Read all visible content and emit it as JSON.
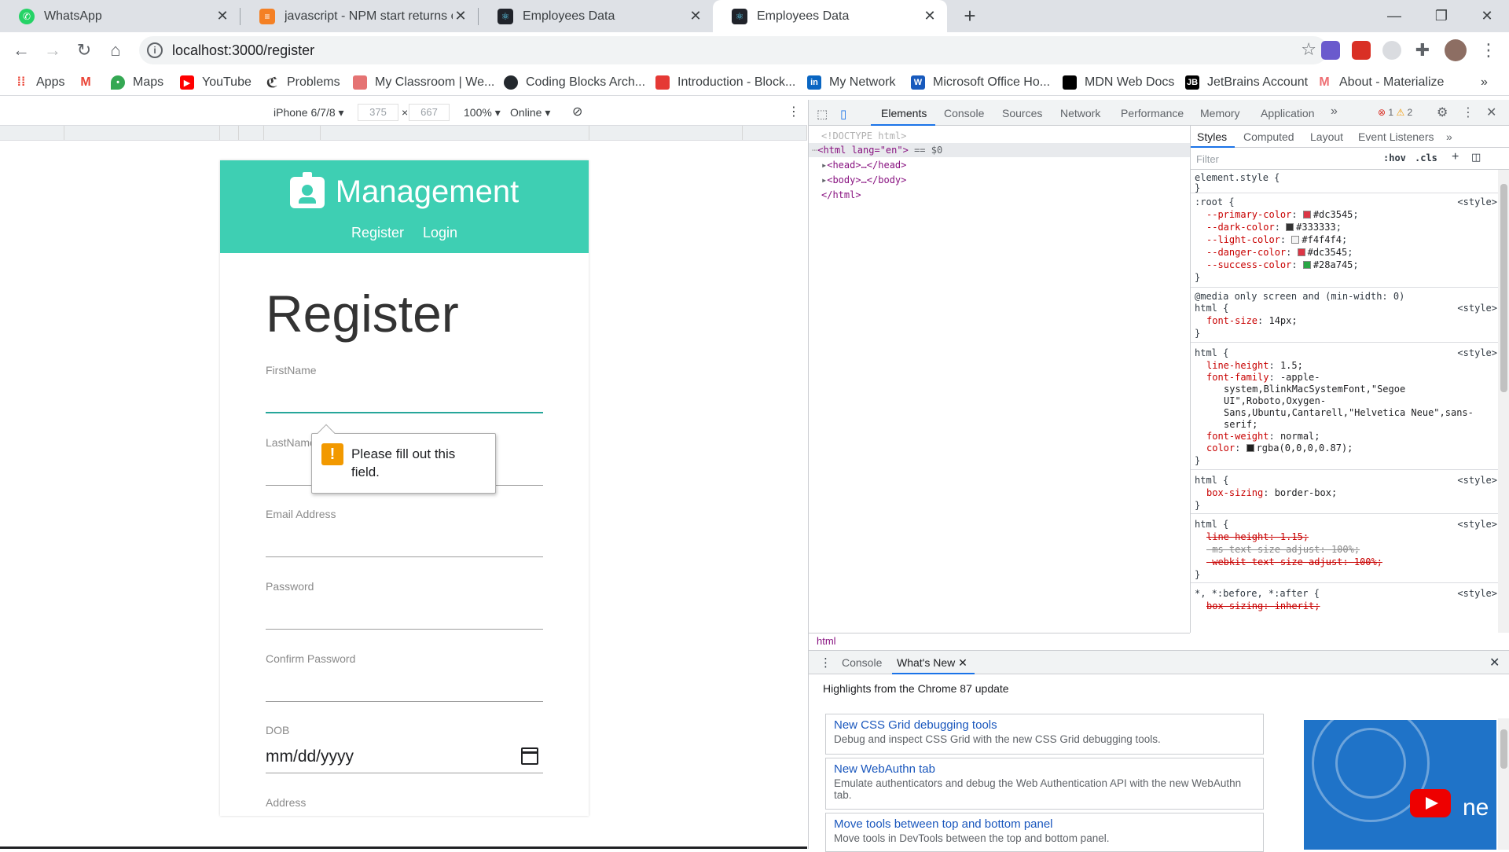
{
  "browser": {
    "tabs": [
      {
        "title": "WhatsApp",
        "icon": "whatsapp-icon"
      },
      {
        "title": "javascript - NPM start returns err",
        "icon": "stackoverflow-icon"
      },
      {
        "title": "Employees Data",
        "icon": "react-icon"
      },
      {
        "title": "Employees Data",
        "icon": "react-icon",
        "active": true
      }
    ],
    "new_tab": "+",
    "url": "localhost:3000/register",
    "bookmarks": [
      {
        "label": "Apps",
        "icon": "apps-grid-icon"
      },
      {
        "label": "",
        "icon": "gmail-icon"
      },
      {
        "label": "Maps",
        "icon": "maps-icon"
      },
      {
        "label": "YouTube",
        "icon": "youtube-icon"
      },
      {
        "label": "Problems",
        "icon": "problems-icon"
      },
      {
        "label": "My Classroom | We...",
        "icon": "classroom-icon"
      },
      {
        "label": "Coding Blocks Arch...",
        "icon": "github-icon"
      },
      {
        "label": "Introduction - Block...",
        "icon": "blocks-icon"
      },
      {
        "label": "My Network",
        "icon": "linkedin-icon"
      },
      {
        "label": "Microsoft Office Ho...",
        "icon": "office-icon"
      },
      {
        "label": "MDN Web Docs",
        "icon": "mdn-icon"
      },
      {
        "label": "JetBrains Account",
        "icon": "jetbrains-icon"
      },
      {
        "label": "About - Materialize",
        "icon": "materialize-icon"
      }
    ]
  },
  "device_toolbar": {
    "device": "iPhone 6/7/8",
    "width": "375",
    "height": "667",
    "zoom": "100%",
    "network": "Online"
  },
  "app": {
    "brand": "Management",
    "nav": [
      "Register",
      "Login"
    ],
    "page_title": "Register",
    "fields": [
      {
        "label": "FirstName",
        "value": ""
      },
      {
        "label": "LastName",
        "value": ""
      },
      {
        "label": "Email Address",
        "value": ""
      },
      {
        "label": "Password",
        "value": ""
      },
      {
        "label": "Confirm Password",
        "value": ""
      },
      {
        "label": "DOB",
        "value": "mm/dd/yyyy"
      },
      {
        "label": "Address",
        "value": ""
      }
    ],
    "validation_message": "Please fill out this field.",
    "colors": {
      "navbar": "#3ecfb3",
      "focus_line": "#26a69a"
    }
  },
  "devtools": {
    "tabs": [
      "Elements",
      "Console",
      "Sources",
      "Network",
      "Performance",
      "Memory",
      "Application"
    ],
    "more": "»",
    "errors": "1",
    "warnings": "2",
    "dom": {
      "doctype": "<!DOCTYPE html>",
      "html_open": "<html lang=\"en\">",
      "selected_marker": "== $0",
      "head": "<head>…</head>",
      "body": "<body>…</body>",
      "html_close": "</html>"
    },
    "breadcrumb": "html",
    "styles_tabs": [
      "Styles",
      "Computed",
      "Layout",
      "Event Listeners"
    ],
    "filter_placeholder": "Filter",
    "hov": ":hov",
    "cls": ".cls",
    "rules": {
      "element_style": "element.style {",
      "root_selector": ":root {",
      "root_props": [
        {
          "name": "--primary-color",
          "value": "#dc3545",
          "swatch": "#dc3545"
        },
        {
          "name": "--dark-color",
          "value": "#333333",
          "swatch": "#333333"
        },
        {
          "name": "--light-color",
          "value": "#f4f4f4",
          "swatch": "#f4f4f4"
        },
        {
          "name": "--danger-color",
          "value": "#dc3545",
          "swatch": "#dc3545"
        },
        {
          "name": "--success-color",
          "value": "#28a745",
          "swatch": "#28a745"
        }
      ],
      "source": "<style>",
      "media_query": "@media only screen and (min-width: 0)",
      "html_selector": "html {",
      "font_size": {
        "name": "font-size",
        "value": "14px;"
      },
      "line_height": {
        "name": "line-height",
        "value": "1.5;"
      },
      "font_family_name": "font-family",
      "font_family_lines": [
        "-apple-",
        "system,BlinkMacSystemFont,\"Segoe",
        "UI\",Roboto,Oxygen-",
        "Sans,Ubuntu,Cantarell,\"Helvetica Neue\",sans-",
        "serif;"
      ],
      "font_weight": {
        "name": "font-weight",
        "value": "normal;"
      },
      "color": {
        "name": "color",
        "value": "rgba(0,0,0,0.87);"
      },
      "box_sizing": {
        "name": "box-sizing",
        "value": "border-box;"
      },
      "struck": [
        "line-height: 1.15;",
        "-ms-text-size-adjust: 100%;",
        "-webkit-text-size-adjust: 100%;"
      ],
      "universal_selector": "*, *:before, *:after {",
      "universal_struck": "box-sizing: inherit;"
    },
    "drawer": {
      "tabs": [
        "Console",
        "What's New"
      ],
      "heading": "Highlights from the Chrome 87 update",
      "cards": [
        {
          "title": "New CSS Grid debugging tools",
          "desc": "Debug and inspect CSS Grid with the new CSS Grid debugging tools."
        },
        {
          "title": "New WebAuthn tab",
          "desc": "Emulate authenticators and debug the Web Authentication API with the new WebAuthn tab."
        },
        {
          "title": "Move tools between top and bottom panel",
          "desc": "Move tools in DevTools between the top and bottom panel."
        }
      ],
      "video_text": "ne"
    }
  }
}
